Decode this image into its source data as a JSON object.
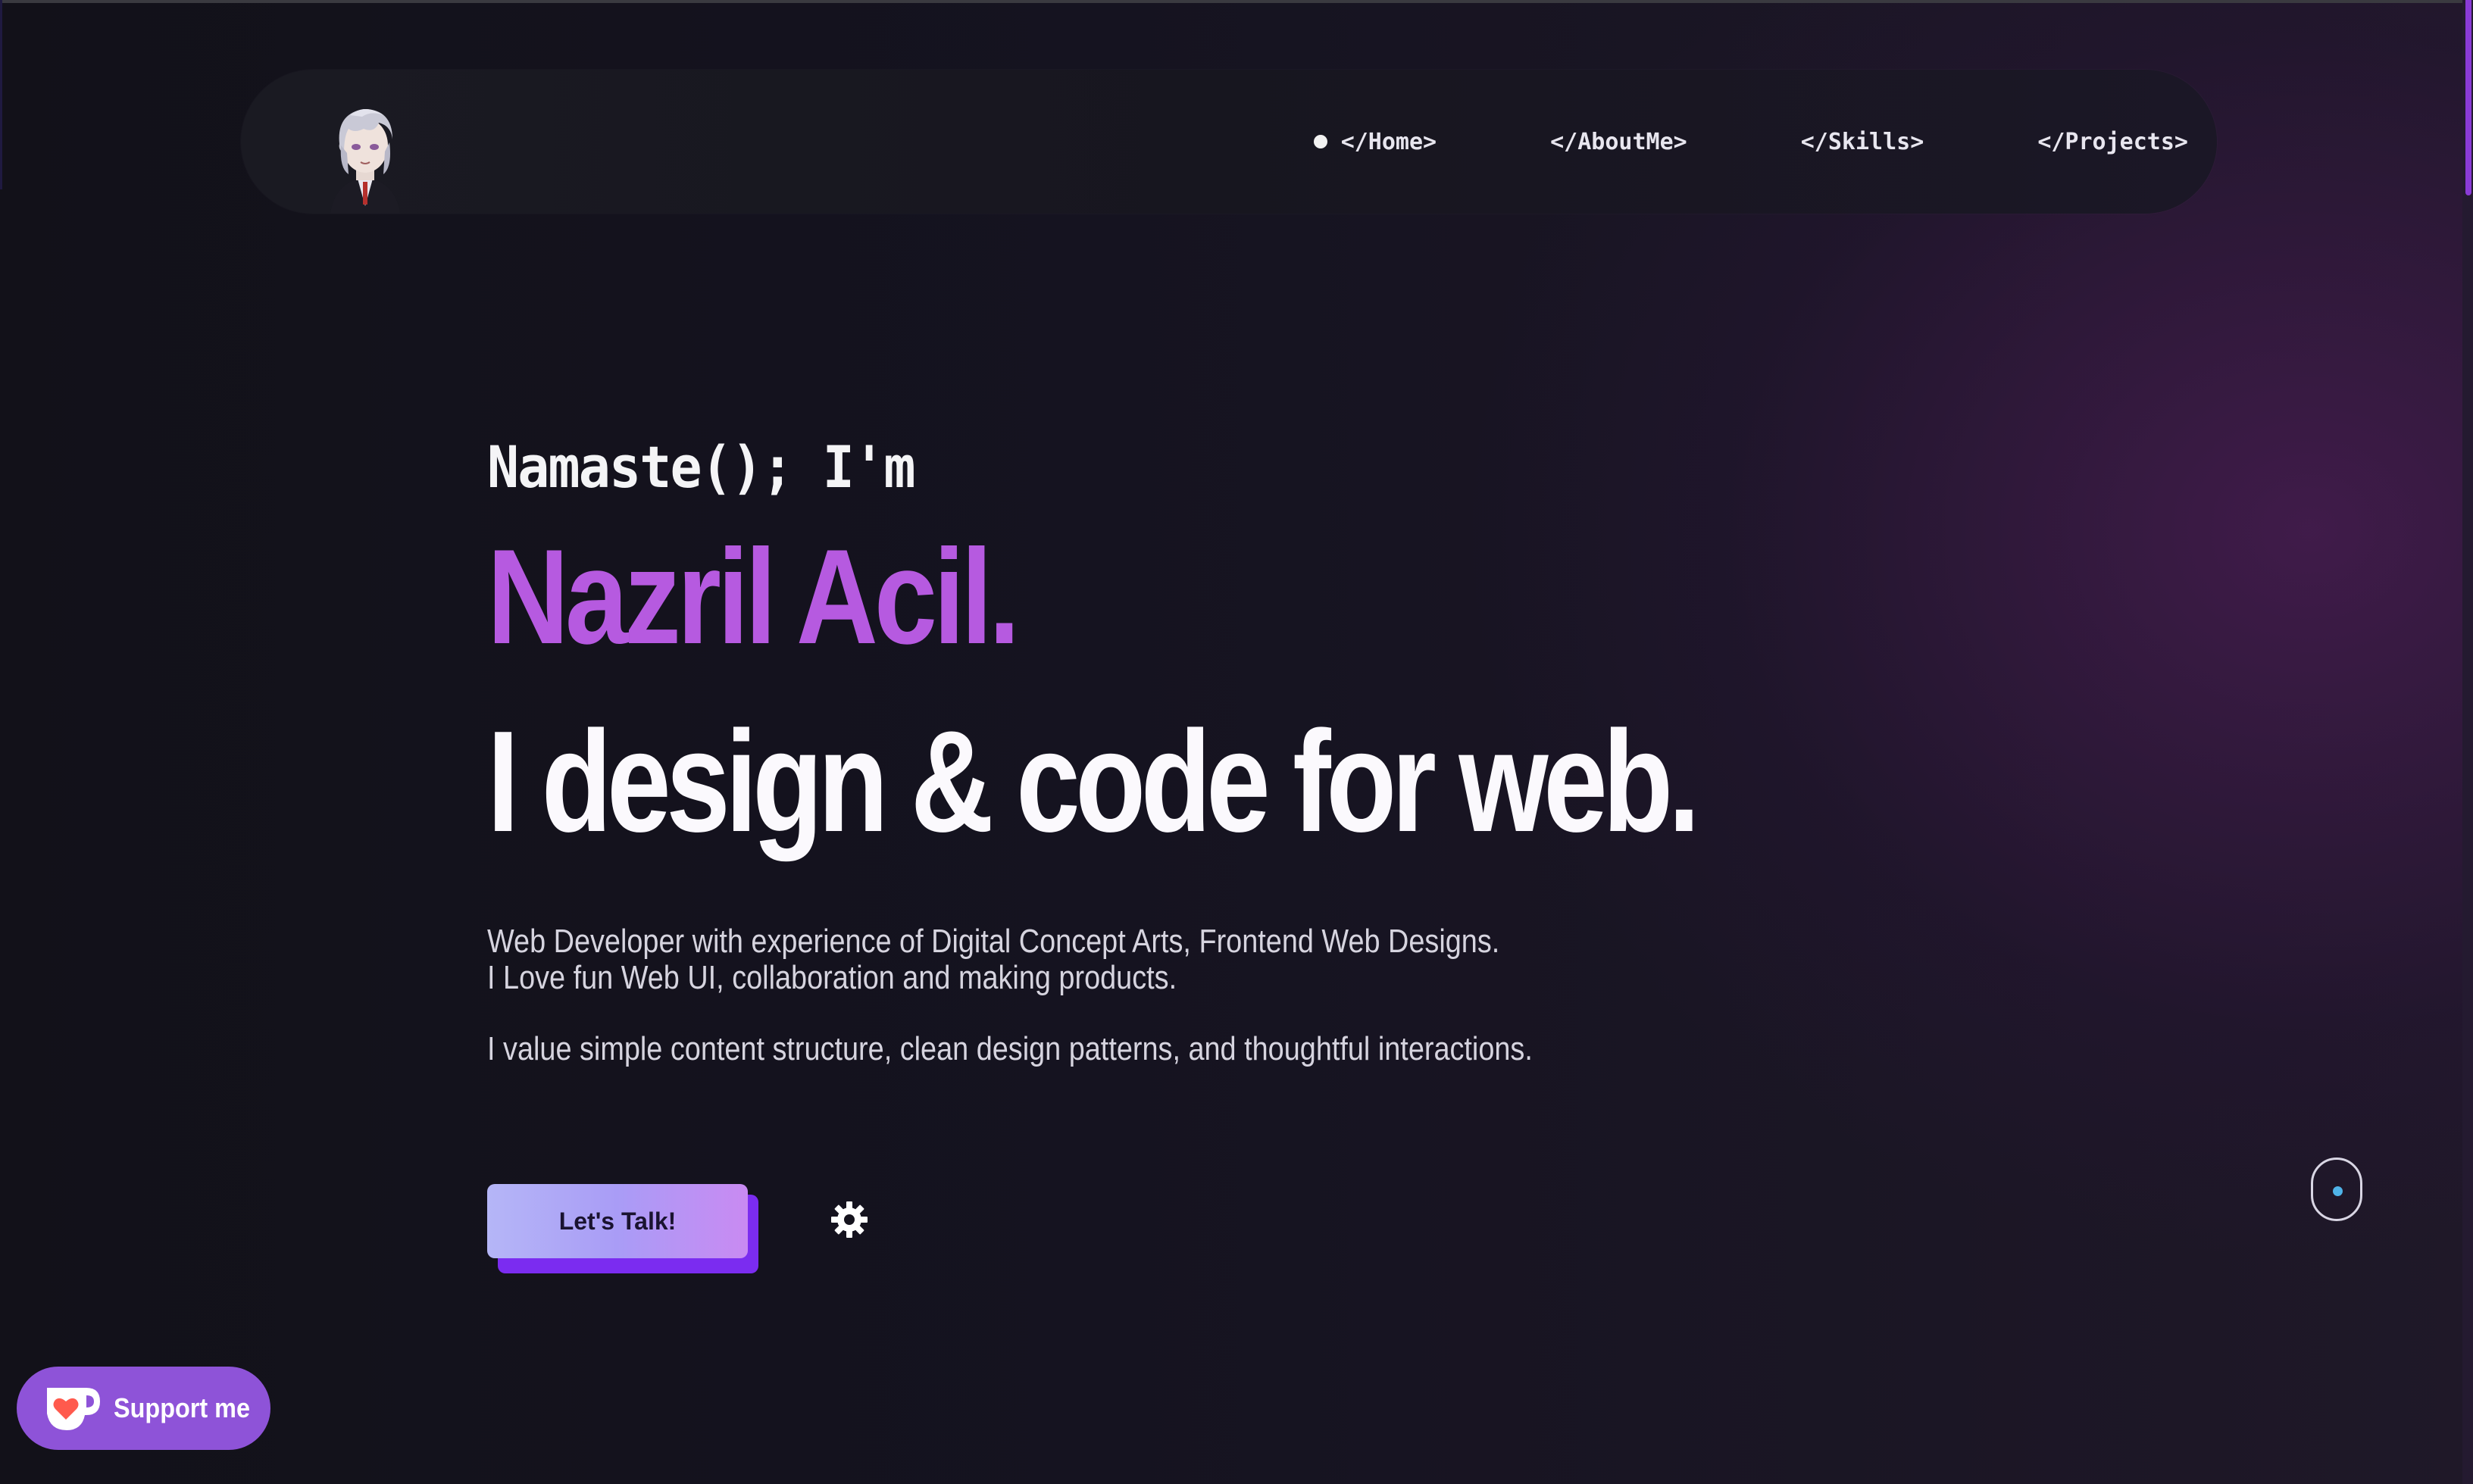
{
  "nav": {
    "items": [
      {
        "label": "</Home>",
        "active": true
      },
      {
        "label": "</AboutMe>",
        "active": false
      },
      {
        "label": "</Skills>",
        "active": false
      },
      {
        "label": "</Projects>",
        "active": false
      }
    ]
  },
  "hero": {
    "greeting": "Namaste(); I'm",
    "name": "Nazril Acil.",
    "tagline": "I design & code for web.",
    "description": "Web Developer with experience of Digital Concept Arts, Frontend Web Designs. I Love fun Web UI, collaboration and making products.",
    "description2": "I value simple content structure, clean design patterns, and thoughtful interactions."
  },
  "cta": {
    "label": "Let's Talk!"
  },
  "support": {
    "label": "Support me"
  },
  "colors": {
    "accent": "#b65ae0",
    "cta_shadow": "#7b2cf0",
    "support_bg": "#8e53d8",
    "scroll_dot": "#4fb3e8"
  },
  "icons": {
    "settings": "gear-icon",
    "support": "ko-fi-cup-icon",
    "scroll": "scroll-indicator-icon"
  }
}
